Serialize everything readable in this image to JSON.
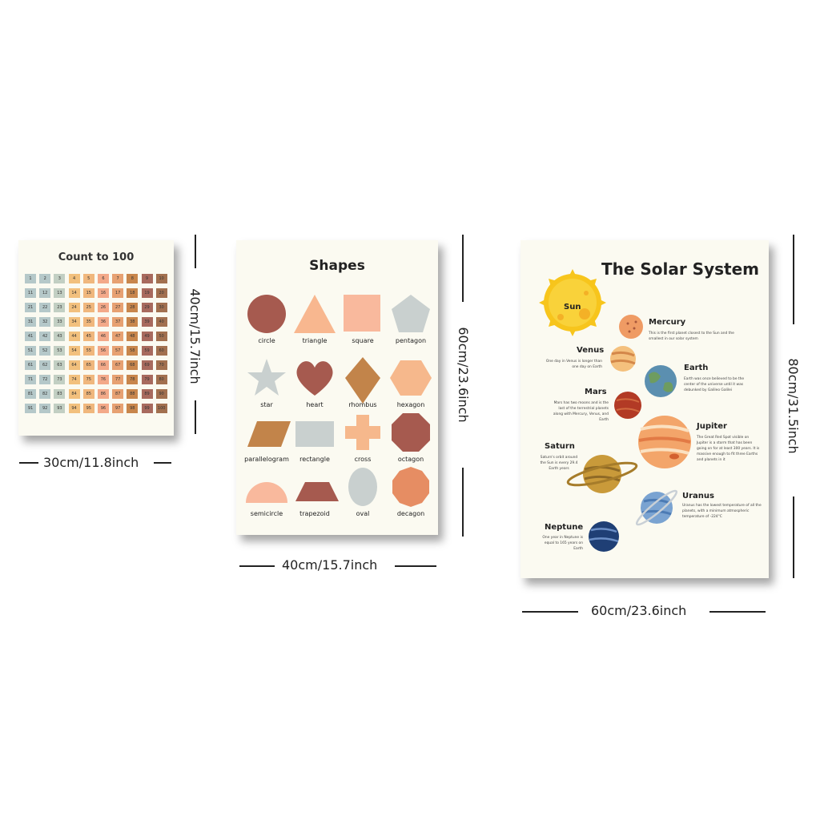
{
  "posters": {
    "count": {
      "title": "Count to 100",
      "numbers": [
        "1",
        "2",
        "3",
        "4",
        "5",
        "6",
        "7",
        "8",
        "9",
        "10",
        "11",
        "12",
        "13",
        "14",
        "15",
        "16",
        "17",
        "18",
        "19",
        "20",
        "21",
        "22",
        "23",
        "24",
        "25",
        "26",
        "27",
        "28",
        "29",
        "30",
        "31",
        "32",
        "33",
        "34",
        "35",
        "36",
        "37",
        "38",
        "39",
        "40",
        "41",
        "42",
        "43",
        "44",
        "45",
        "46",
        "47",
        "48",
        "49",
        "50",
        "51",
        "52",
        "53",
        "54",
        "55",
        "56",
        "57",
        "58",
        "59",
        "60",
        "61",
        "62",
        "63",
        "64",
        "65",
        "66",
        "67",
        "68",
        "69",
        "70",
        "71",
        "72",
        "73",
        "74",
        "75",
        "76",
        "77",
        "78",
        "79",
        "80",
        "81",
        "82",
        "83",
        "84",
        "85",
        "86",
        "87",
        "88",
        "89",
        "90",
        "91",
        "92",
        "93",
        "94",
        "95",
        "96",
        "97",
        "98",
        "99",
        "100"
      ],
      "column_colors": [
        "#b5c8c9",
        "#b5c8c9",
        "#c2cfc3",
        "#f2c07d",
        "#f0b77d",
        "#f3a989",
        "#e7a172",
        "#c8864c",
        "#a86a5e",
        "#a2704f"
      ],
      "width_label": "30cm/11.8inch",
      "height_label": "40cm/15.7inch"
    },
    "shapes": {
      "title": "Shapes",
      "items": [
        {
          "label": "circle",
          "color": "#a65a4f"
        },
        {
          "label": "triangle",
          "color": "#f8b78f"
        },
        {
          "label": "square",
          "color": "#f9b99d"
        },
        {
          "label": "pentagon",
          "color": "#c9d0cf"
        },
        {
          "label": "star",
          "color": "#c9d0cf"
        },
        {
          "label": "heart",
          "color": "#a65a4f"
        },
        {
          "label": "rhombus",
          "color": "#c2844a"
        },
        {
          "label": "hexagon",
          "color": "#f6b88c"
        },
        {
          "label": "parallelogram",
          "color": "#c2844a"
        },
        {
          "label": "rectangle",
          "color": "#c9d0cf"
        },
        {
          "label": "cross",
          "color": "#f6b88c"
        },
        {
          "label": "octagon",
          "color": "#a65a4f"
        },
        {
          "label": "semicircle",
          "color": "#f9b99d"
        },
        {
          "label": "trapezoid",
          "color": "#a65a4f"
        },
        {
          "label": "oval",
          "color": "#c9d0cf"
        },
        {
          "label": "decagon",
          "color": "#e68d63"
        }
      ],
      "width_label": "40cm/15.7inch",
      "height_label": "60cm/23.6inch"
    },
    "solar": {
      "title": "The Solar System",
      "sun": "Sun",
      "planets": {
        "mercury": {
          "name": "Mercury",
          "desc": "This is the first planet closest to the Sun and the smallest in our solar system"
        },
        "venus": {
          "name": "Venus",
          "desc": "One day in Venus is longer than one day on Earth"
        },
        "earth": {
          "name": "Earth",
          "desc": "Earth was once believed to be the center of the universe until it was debunked by Galileo Galilei"
        },
        "mars": {
          "name": "Mars",
          "desc": "Mars has two moons and is the last of the terrestrial planets along with Mercury, Venus, and Earth"
        },
        "jupiter": {
          "name": "Jupiter",
          "desc": "The Great Red Spot visible on Jupiter is a storm that has been going on for at least 300 years. It is massive enough to fit three Earths and planets in it"
        },
        "saturn": {
          "name": "Saturn",
          "desc": "Saturn's orbit around the Sun is every 29.4 Earth years"
        },
        "uranus": {
          "name": "Uranus",
          "desc": "Uranus has the lowest temperature of all the planets, with a minimum atmospheric temperature of -224°C"
        },
        "neptune": {
          "name": "Neptune",
          "desc": "One year in Neptune is equal to 165 years on Earth"
        }
      },
      "width_label": "60cm/23.6inch",
      "height_label": "80cm/31.5inch"
    }
  }
}
